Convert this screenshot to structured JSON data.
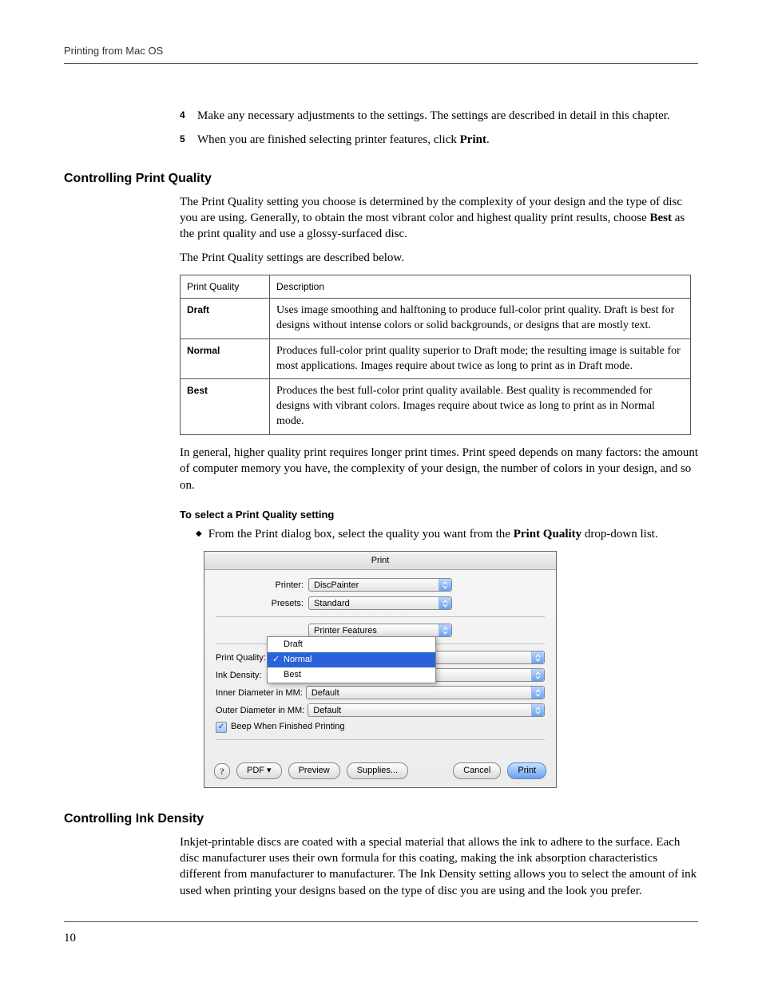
{
  "header": "Printing from Mac OS",
  "page_number": "10",
  "steps": [
    {
      "num": "4",
      "text_a": "Make any necessary adjustments to the settings. The settings are described in detail in this chapter."
    },
    {
      "num": "5",
      "text_a": "When you are finished selecting printer features, click ",
      "bold": "Print",
      "text_b": "."
    }
  ],
  "sec1": {
    "title": "Controlling Print Quality",
    "p1a": "The Print Quality setting you choose is determined by the complexity of your design and the type of disc you are using. Generally, to obtain the most vibrant color and highest quality print results, choose ",
    "p1bold": "Best",
    "p1b": " as the print quality and use a glossy-surfaced disc.",
    "p2": "The Print Quality settings are described below.",
    "table": {
      "h1": "Print Quality",
      "h2": "Description",
      "rows": [
        {
          "k": "Draft",
          "v": "Uses image smoothing and halftoning to produce full-color print quality. Draft is best for designs without intense colors or solid backgrounds, or designs that are mostly text."
        },
        {
          "k": "Normal",
          "v": "Produces full-color print quality superior to Draft mode; the resulting image is suitable for most applications. Images require about twice as long to print as in Draft mode."
        },
        {
          "k": "Best",
          "v": "Produces the best full-color print quality available. Best quality is recommended for designs with vibrant colors. Images require about twice as long to print as in Normal mode."
        }
      ]
    },
    "p3": "In general, higher quality print requires longer print times. Print speed depends on many factors: the amount of computer memory you have, the complexity of your design, the number of colors in your design, and so on.",
    "subhead": "To select a Print Quality setting",
    "bullet_a": "From the Print dialog box, select the quality you want from the ",
    "bullet_bold": "Print Quality",
    "bullet_b": " drop-down list."
  },
  "dialog": {
    "title": "Print",
    "printer_lbl": "Printer:",
    "printer_val": "DiscPainter",
    "presets_lbl": "Presets:",
    "presets_val": "Standard",
    "pane_val": "Printer Features",
    "pq_lbl": "Print Quality:",
    "pq_options": [
      "Draft",
      "Normal",
      "Best"
    ],
    "pq_selected": "Normal",
    "density_lbl": "Ink Density:",
    "inner_lbl": "Inner Diameter in MM:",
    "inner_val": "Default",
    "outer_lbl": "Outer Diameter in MM:",
    "outer_val": "Default",
    "beep": "Beep When Finished Printing",
    "help": "?",
    "pdf": "PDF ▾",
    "preview": "Preview",
    "supplies": "Supplies...",
    "cancel": "Cancel",
    "print": "Print"
  },
  "sec2": {
    "title": "Controlling Ink Density",
    "p1": "Inkjet-printable discs are coated with a special material that allows the ink to adhere to the surface. Each disc manufacturer uses their own formula for this coating, making the ink absorption characteristics different from manufacturer to manufacturer. The Ink Density setting allows you to select the amount of ink used when printing your designs based on the type of disc you are using and the look you prefer."
  }
}
